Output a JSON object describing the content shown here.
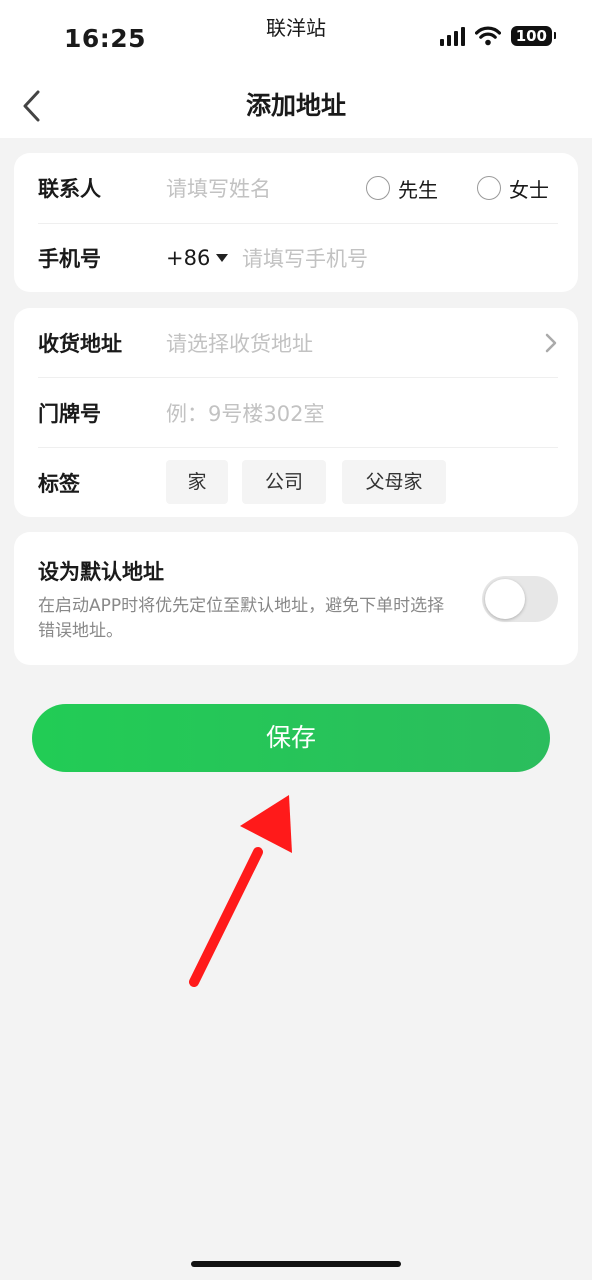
{
  "status": {
    "time": "16:25",
    "carrier": "联洋站",
    "battery": "100"
  },
  "header": {
    "title": "添加地址"
  },
  "contact": {
    "name_label": "联系人",
    "name_placeholder": "请填写姓名",
    "gender_options": [
      "先生",
      "女士"
    ],
    "phone_label": "手机号",
    "country_code": "+86",
    "phone_placeholder": "请填写手机号"
  },
  "address": {
    "address_label": "收货地址",
    "address_placeholder": "请选择收货地址",
    "door_label": "门牌号",
    "door_placeholder": "例：9号楼302室",
    "tag_label": "标签",
    "tags": [
      "家",
      "公司",
      "父母家"
    ]
  },
  "default_address": {
    "title": "设为默认地址",
    "description": "在启动APP时将优先定位至默认地址，避免下单时选择错误地址。",
    "enabled": false
  },
  "save_label": "保存",
  "colors": {
    "accent": "#22cc55",
    "annotation_arrow": "#ff1a1a"
  }
}
